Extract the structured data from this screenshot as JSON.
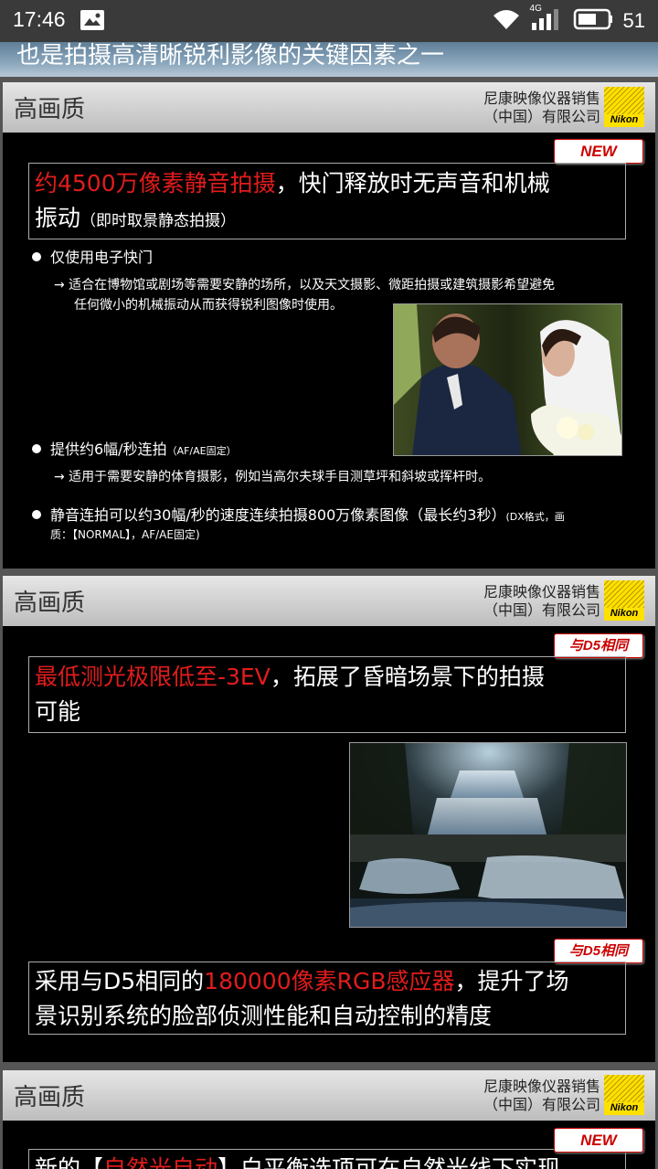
{
  "status_bar": {
    "time": "17:46",
    "network": "4G",
    "battery": "51"
  },
  "top_banner": {
    "text": "也是拍摄高清晰锐利影像的关键因素之一"
  },
  "slides": [
    {
      "title": "高画质",
      "company_line1": "尼康映像仪器销售",
      "company_line2": "（中国）有限公司",
      "logo_text": "Nikon",
      "tag": "NEW",
      "headline_red": "约4500万像素静音拍摄",
      "headline_rest": "，快门释放时无声音和机械",
      "headline_line2": "振动",
      "headline_note": "（即时取景静态拍摄）",
      "bullet1": "仅使用电子快门",
      "bullet1_note1": "→ 适合在博物馆或剧场等需要安静的场所，以及天文摄影、微距拍摄或建筑摄影希望避免",
      "bullet1_note2": "任何微小的机械振动从而获得锐利图像时使用。",
      "bullet2": "提供约6幅/秒连拍",
      "bullet2_small": "（AF/AE固定）",
      "bullet2_note": "→ 适用于需要安静的体育摄影，例如当高尔夫球手目测草坪和斜坡或挥杆时。",
      "bullet3": "静音连拍可以约30幅/秒的速度连续拍摄800万像素图像（最长约3秒）",
      "bullet3_small": "(DX格式，画",
      "bullet3_small2": "质：【NORMAL】，AF/AE固定)"
    },
    {
      "title": "高画质",
      "company_line1": "尼康映像仪器销售",
      "company_line2": "（中国）有限公司",
      "logo_text": "Nikon",
      "tag": "与D5相同",
      "headline_red": "最低测光极限低至-3EV",
      "headline_rest": "，拓展了昏暗场景下的拍摄",
      "headline_line2": "可能",
      "tag2": "与D5相同",
      "headline2_pre": "采用与D5相同的",
      "headline2_red": "180000像素RGB感应器",
      "headline2_rest": "，提升了场",
      "headline2_line2": "景识别系统的脸部侦测性能和自动控制的精度"
    },
    {
      "title": "高画质",
      "company_line1": "尼康映像仪器销售",
      "company_line2": "（中国）有限公司",
      "logo_text": "Nikon",
      "tag": "NEW",
      "headline_pre": "新的【",
      "headline_red": "自然光自动",
      "headline_rest": "】白平衡选项可在自然光线下实现"
    }
  ]
}
